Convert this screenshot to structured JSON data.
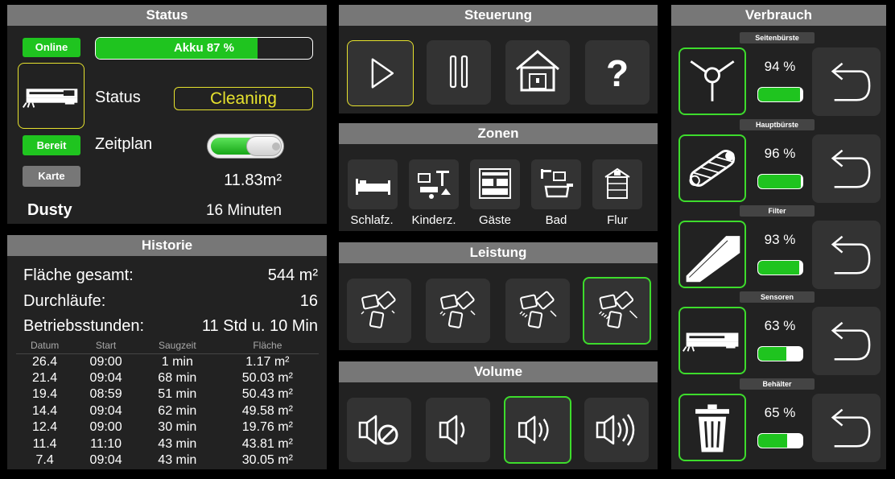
{
  "status": {
    "title": "Status",
    "online": "Online",
    "battery_label": "Akku 87 %",
    "battery_level": 0.87,
    "status_label": "Status",
    "status_value": "Cleaning",
    "ready": "Bereit",
    "schedule_label": "Zeitplan",
    "schedule_on": true,
    "map": "Karte",
    "area": "11.83m²",
    "name": "Dusty",
    "duration": "16 Minuten"
  },
  "history": {
    "title": "Historie",
    "total_area_label": "Fläche gesamt:",
    "total_area": "544 m²",
    "runs_label": "Durchläufe:",
    "runs": "16",
    "hours_label": "Betriebsstunden:",
    "hours": "11 Std u. 10 Min",
    "columns": [
      "Datum",
      "Start",
      "Saugzeit",
      "Fläche"
    ],
    "rows": [
      [
        "26.4",
        "09:00",
        "1 min",
        "1.17 m²"
      ],
      [
        "21.4",
        "09:04",
        "68 min",
        "50.03 m²"
      ],
      [
        "19.4",
        "08:59",
        "51 min",
        "50.43 m²"
      ],
      [
        "14.4",
        "09:04",
        "62 min",
        "49.58 m²"
      ],
      [
        "12.4",
        "09:00",
        "30 min",
        "19.76 m²"
      ],
      [
        "11.4",
        "11:10",
        "43 min",
        "43.81 m²"
      ],
      [
        "7.4",
        "09:04",
        "43 min",
        "30.05 m²"
      ]
    ]
  },
  "control": {
    "title": "Steuerung",
    "help": "?"
  },
  "zones": {
    "title": "Zonen",
    "items": [
      "Schlafz.",
      "Kinderz.",
      "Gäste",
      "Bad",
      "Flur"
    ]
  },
  "power": {
    "title": "Leistung",
    "selected_index": 3
  },
  "volume": {
    "title": "Volume",
    "selected_index": 2
  },
  "consumption": {
    "title": "Verbrauch",
    "items": [
      {
        "label": "Seitenbürste",
        "pct": "94 %",
        "level": 0.94,
        "icon": "side-brush-icon"
      },
      {
        "label": "Hauptbürste",
        "pct": "96 %",
        "level": 0.96,
        "icon": "main-brush-icon"
      },
      {
        "label": "Filter",
        "pct": "93 %",
        "level": 0.93,
        "icon": "filter-icon"
      },
      {
        "label": "Sensoren",
        "pct": "63 %",
        "level": 0.63,
        "icon": "robot-icon"
      },
      {
        "label": "Behälter",
        "pct": "65 %",
        "level": 0.65,
        "icon": "trash-icon"
      }
    ]
  },
  "colors": {
    "accent_green": "#1fc41f",
    "highlight_yellow": "#e6e22e",
    "panel": "#222222"
  }
}
